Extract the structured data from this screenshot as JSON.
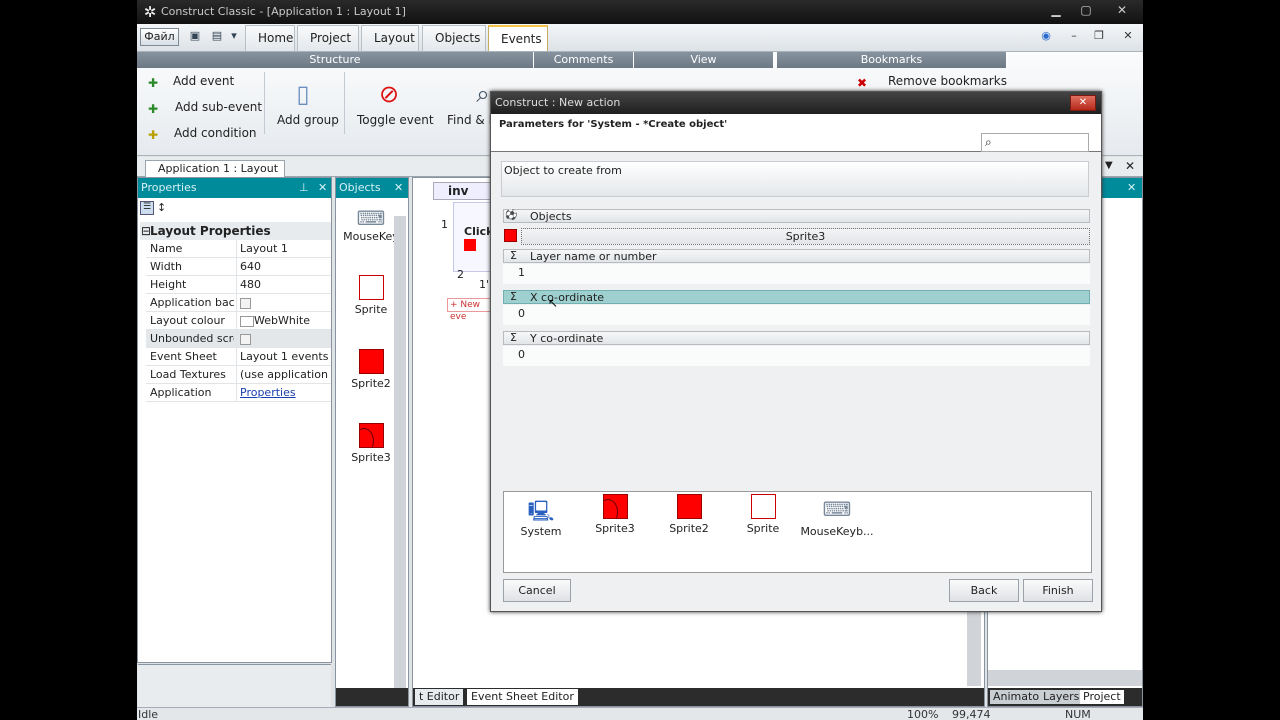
{
  "window": {
    "title": "Construct Classic - [Application 1 : Layout 1]"
  },
  "file_button": "Файл",
  "tabs": [
    "Home",
    "Project",
    "Layout",
    "Objects",
    "Events"
  ],
  "ribbon": {
    "groups": [
      "Structure",
      "Comments",
      "View",
      "Bookmarks"
    ],
    "add_event": "Add event",
    "add_sub_event": "Add sub-event",
    "add_condition": "Add condition",
    "add_group": "Add group",
    "toggle_event": "Toggle event",
    "find_replace": "Find & Re",
    "remove_bookmarks": "Remove bookmarks"
  },
  "doc_tab": "Application 1 : Layout 1",
  "properties": {
    "header": "Properties",
    "section": "Layout Properties",
    "rows": [
      {
        "k": "Name",
        "v": "Layout 1"
      },
      {
        "k": "Width",
        "v": "640"
      },
      {
        "k": "Height",
        "v": "480"
      },
      {
        "k": "Application backg",
        "v": ""
      },
      {
        "k": "Layout colour",
        "v": "WebWhite"
      },
      {
        "k": "Unbounded scrol",
        "v": ""
      },
      {
        "k": "Event Sheet",
        "v": "Layout 1 events"
      },
      {
        "k": "Load Textures",
        "v": "(use application setti"
      },
      {
        "k": "Application",
        "v": "Properties"
      }
    ]
  },
  "objects_panel": {
    "header": "Objects",
    "items": [
      "MouseKey",
      "Sprite",
      "Sprite2",
      "Sprite3"
    ]
  },
  "event_sheet": {
    "title": "inv",
    "row1": "1",
    "row2": "2",
    "event_text": "Clicke",
    "sub_text": "1'",
    "new_event": "+ New eve",
    "bottom_tabs": [
      "t Editor",
      "Event Sheet Editor"
    ]
  },
  "right_tabs": [
    "Animator",
    "Layers",
    "Project"
  ],
  "status": {
    "left": "Idle",
    "zoom": "100%",
    "coords": "99,474",
    "num": "NUM"
  },
  "dialog": {
    "title": "Construct : New action",
    "heading": "Parameters for 'System - *Create object'",
    "search_placeholder": "",
    "description": "Object to create from",
    "params": {
      "objects_label": "Objects",
      "objects_value": "Sprite3",
      "layer_label": "Layer name or number",
      "layer_value": "1",
      "x_label": "X co-ordinate",
      "x_value": "0",
      "y_label": "Y co-ordinate",
      "y_value": "0"
    },
    "picker": [
      "System",
      "Sprite3",
      "Sprite2",
      "Sprite",
      "MouseKeyb..."
    ],
    "cancel": "Cancel",
    "back": "Back",
    "finish": "Finish"
  }
}
